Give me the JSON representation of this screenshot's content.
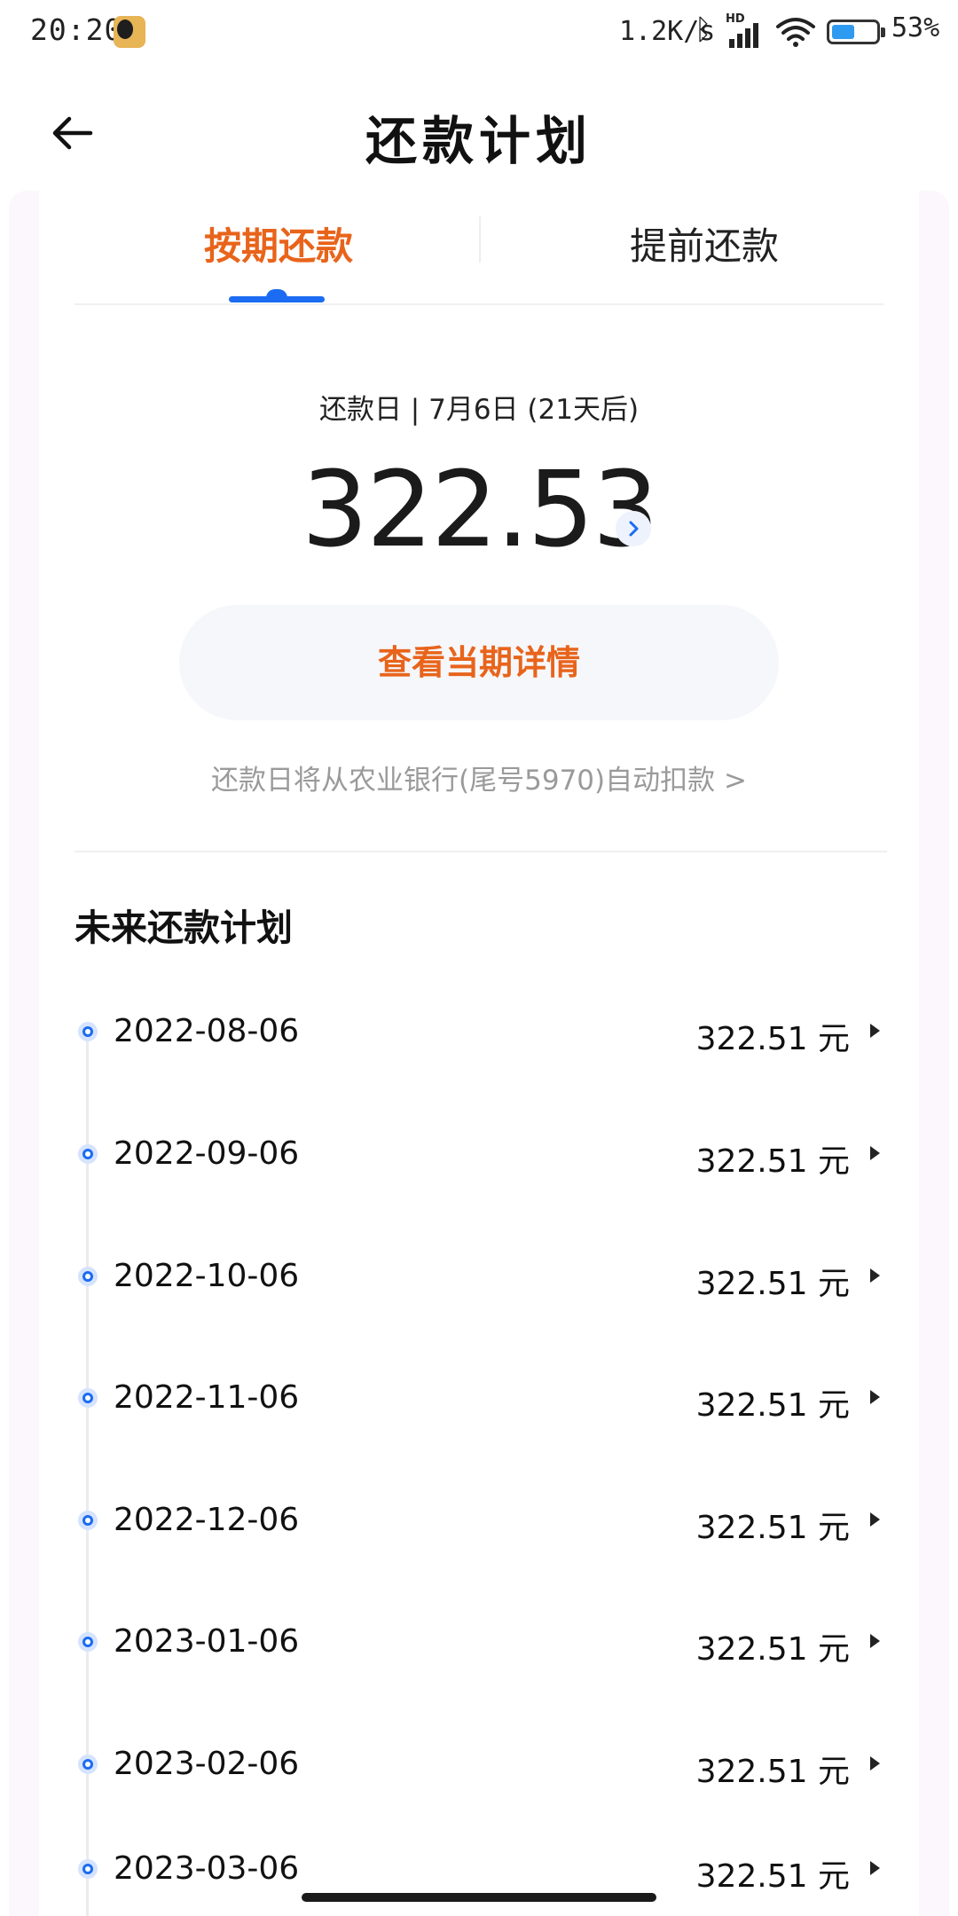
{
  "status_bar": {
    "time": "20:20",
    "net_speed": "1.2K/s",
    "hd_label": "HD",
    "battery_percent": 53,
    "battery_text": "53%"
  },
  "header": {
    "title": "还款计划"
  },
  "tabs": [
    {
      "label": "按期还款",
      "active": true
    },
    {
      "label": "提前还款",
      "active": false
    }
  ],
  "due": {
    "line": "还款日 | 7月6日 (21天后)",
    "amount": "322.53"
  },
  "detail_button": "查看当期详情",
  "autopay_text": "还款日将从农业银行(尾号5970)自动扣款 >",
  "future_plan": {
    "title": "未来还款计划",
    "rows": [
      {
        "date": "2022-08-06",
        "amount": "322.51 元"
      },
      {
        "date": "2022-09-06",
        "amount": "322.51 元"
      },
      {
        "date": "2022-10-06",
        "amount": "322.51 元"
      },
      {
        "date": "2022-11-06",
        "amount": "322.51 元"
      },
      {
        "date": "2022-12-06",
        "amount": "322.51 元"
      },
      {
        "date": "2023-01-06",
        "amount": "322.51 元"
      },
      {
        "date": "2023-02-06",
        "amount": "322.51 元"
      },
      {
        "date": "2023-03-06",
        "amount": "322.51 元"
      }
    ]
  },
  "colors": {
    "accent_orange": "#e8641b",
    "accent_blue": "#1b6cf2",
    "battery": "#2f9bf0"
  }
}
